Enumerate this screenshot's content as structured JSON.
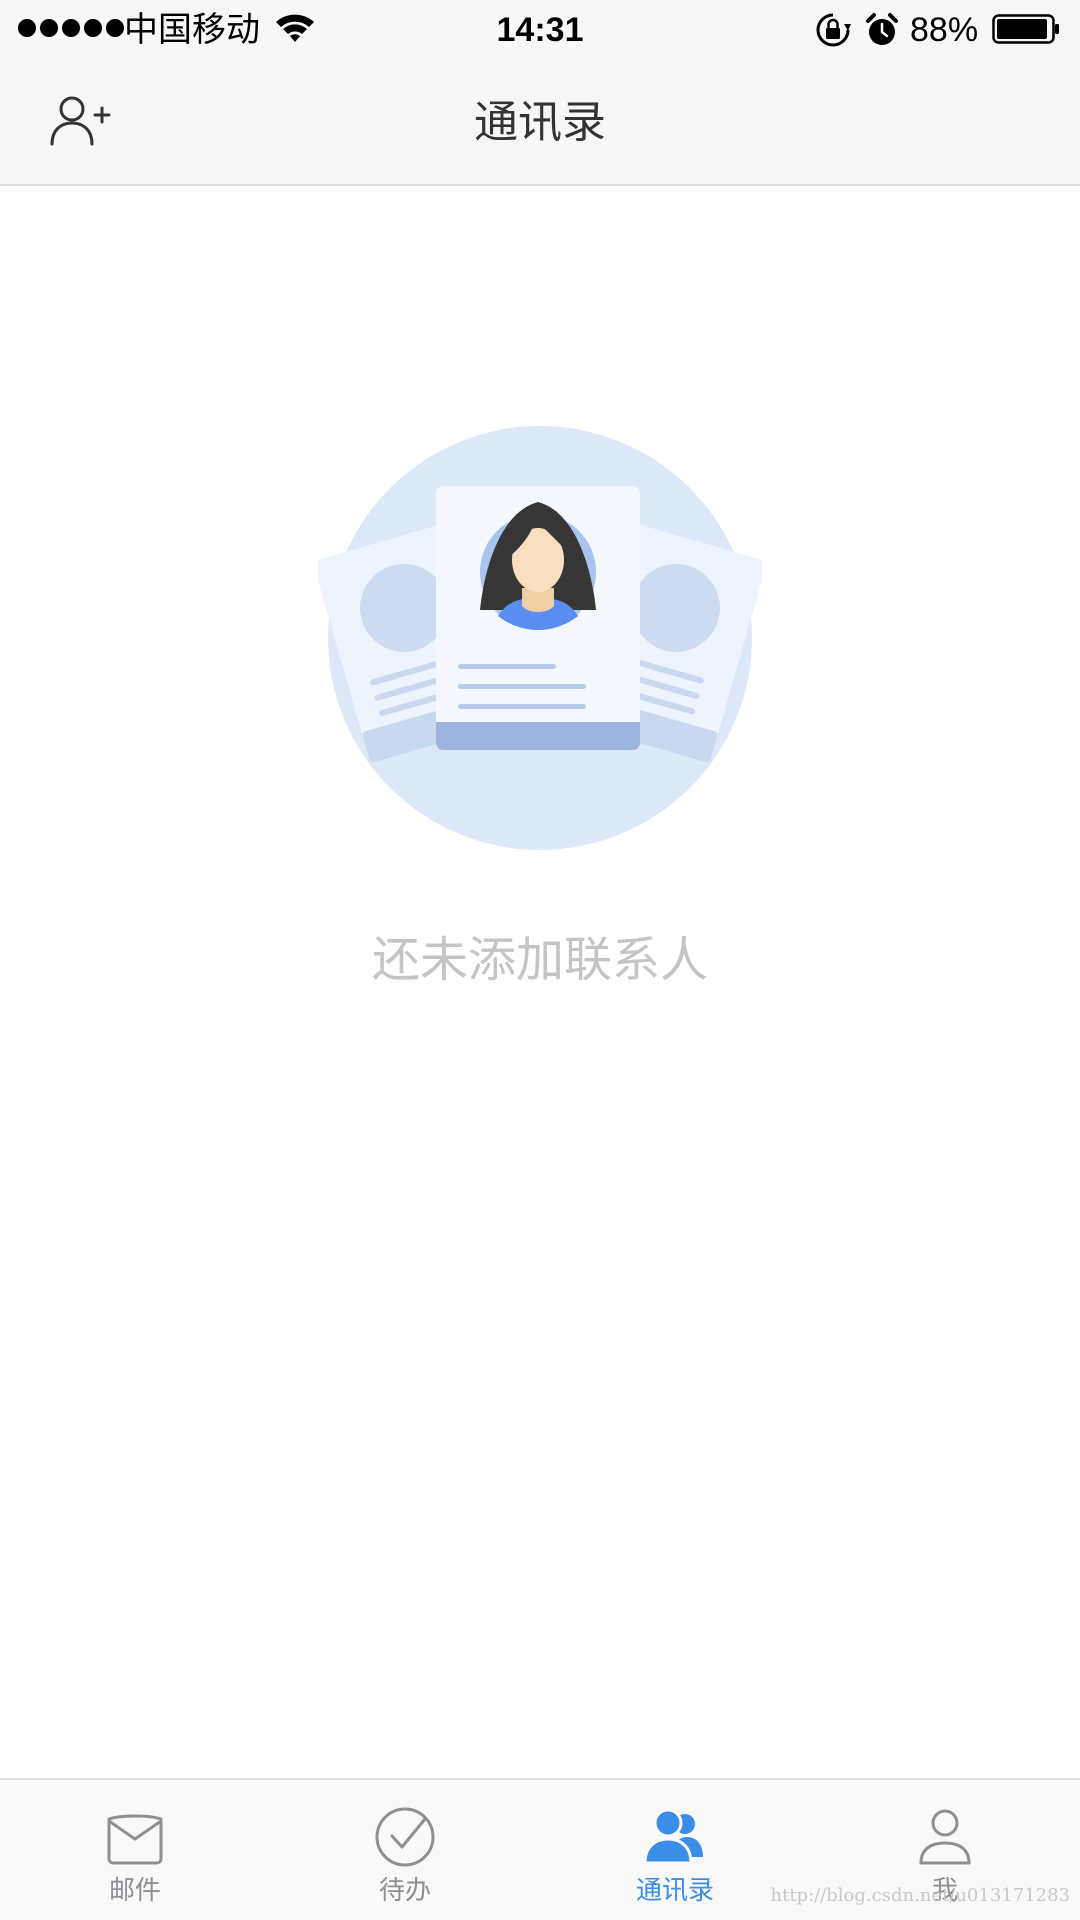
{
  "status_bar": {
    "carrier": "中国移动",
    "time": "14:31",
    "battery_percent": "88%",
    "icons": [
      "signal-dots-icon",
      "wifi-icon",
      "rotation-lock-icon",
      "alarm-icon",
      "battery-icon"
    ]
  },
  "nav": {
    "title": "通讯录",
    "left_icon": "add-contact-icon"
  },
  "empty_state": {
    "message": "还未添加联系人",
    "illustration": "contact-cards-illustration"
  },
  "tab_bar": {
    "active_index": 2,
    "accent_color": "#3a8ee6",
    "inactive_color": "#8e8e93",
    "tabs": [
      {
        "label": "邮件",
        "icon": "mail-icon"
      },
      {
        "label": "待办",
        "icon": "todo-check-icon"
      },
      {
        "label": "通讯录",
        "icon": "contacts-icon"
      },
      {
        "label": "我",
        "icon": "profile-icon"
      }
    ]
  },
  "watermark": "http://blog.csdn.net/u013171283"
}
